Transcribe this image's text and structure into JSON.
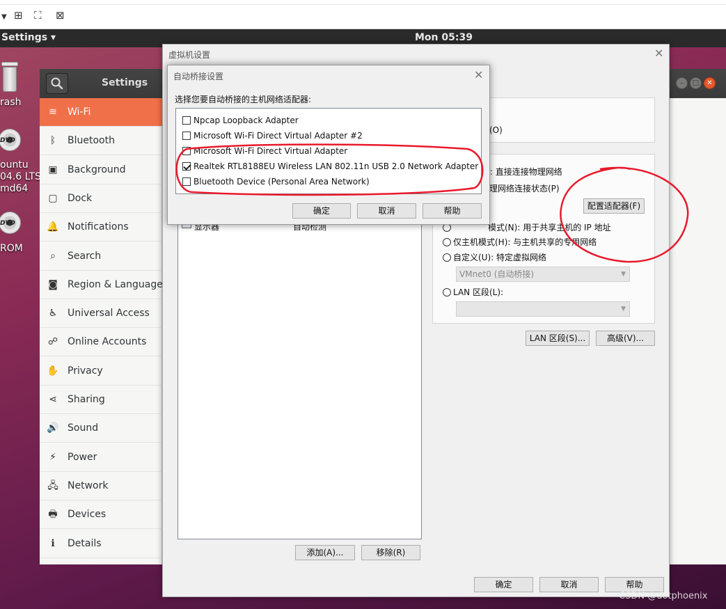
{
  "host_toolbar": {
    "icons": [
      "dropdown-arrow-icon",
      "share-icon",
      "fit-window-icon",
      "no-stretch-icon"
    ]
  },
  "topbar": {
    "app_menu": "Settings ▾",
    "clock": "Mon 05:39"
  },
  "desktop": {
    "trash_label": "rash",
    "dvd_label_lines": [
      "ountu",
      "04.6 LTS",
      "md64"
    ],
    "cdrom_label": "ROM"
  },
  "settings": {
    "title": "Settings",
    "items": [
      {
        "label": "Wi-Fi",
        "icon": "wifi-icon",
        "glyph": "≋",
        "active": true
      },
      {
        "label": "Bluetooth",
        "icon": "bluetooth-icon",
        "glyph": "ᛒ"
      },
      {
        "label": "Background",
        "icon": "background-icon",
        "glyph": "▣"
      },
      {
        "label": "Dock",
        "icon": "dock-icon",
        "glyph": "▢"
      },
      {
        "label": "Notifications",
        "icon": "bell-icon",
        "glyph": "🔔"
      },
      {
        "label": "Search",
        "icon": "search-icon",
        "glyph": "⌕"
      },
      {
        "label": "Region & Language",
        "icon": "camera-icon",
        "glyph": "◙"
      },
      {
        "label": "Universal Access",
        "icon": "accessibility-icon",
        "glyph": "♿"
      },
      {
        "label": "Online Accounts",
        "icon": "online-accounts-icon",
        "glyph": "☍"
      },
      {
        "label": "Privacy",
        "icon": "hand-icon",
        "glyph": "✋"
      },
      {
        "label": "Sharing",
        "icon": "share-icon",
        "glyph": "⋖"
      },
      {
        "label": "Sound",
        "icon": "speaker-icon",
        "glyph": "🔊"
      },
      {
        "label": "Power",
        "icon": "power-icon",
        "glyph": "⚡"
      },
      {
        "label": "Network",
        "icon": "network-icon",
        "glyph": "🖧"
      },
      {
        "label": "Devices",
        "icon": "devices-icon",
        "glyph": "🖶"
      },
      {
        "label": "Details",
        "icon": "info-icon",
        "glyph": "ℹ"
      }
    ]
  },
  "vm_dialog": {
    "title": "虚拟机设置",
    "visible_fragments": {
      "connected_tail": "接(O)"
    },
    "device_row": {
      "name": "显示器",
      "summary": "自动检测"
    },
    "add_button": "添加(A)...",
    "remove_button": "移除(R)",
    "network_options": {
      "bridged_tail": "B): 直接连接物理网络",
      "replicate_tail": "物理网络连接状态(P)",
      "configure_button": "配置适配器(F)",
      "nat_tail": "模式(N): 用于共享主机的 IP 地址",
      "host_only": "仅主机模式(H): 与主机共享的专用网络",
      "custom": "自定义(U): 特定虚拟网络",
      "custom_combo_value": "VMnet0 (自动桥接)",
      "lan_segment": "LAN 区段(L):",
      "lan_combo_value": ""
    },
    "lan_segments_button": "LAN 区段(S)...",
    "advanced_button": "高级(V)...",
    "ok": "确定",
    "cancel": "取消",
    "help": "帮助"
  },
  "bridge_dialog": {
    "title": "自动桥接设置",
    "prompt": "选择您要自动桥接的主机网络适配器:",
    "adapters": [
      {
        "name": "Npcap Loopback Adapter",
        "checked": false
      },
      {
        "name": "Microsoft Wi-Fi Direct Virtual Adapter #2",
        "checked": false
      },
      {
        "name": "Microsoft Wi-Fi Direct Virtual Adapter",
        "checked": false
      },
      {
        "name": "Realtek RTL8188EU Wireless LAN 802.11n USB 2.0 Network Adapter",
        "checked": true
      },
      {
        "name": "Bluetooth Device (Personal Area Network)",
        "checked": false
      }
    ],
    "ok": "确定",
    "cancel": "取消",
    "help": "帮助"
  },
  "annotation_color": "#e8192c",
  "watermark": "CSDN @dotphoenix"
}
